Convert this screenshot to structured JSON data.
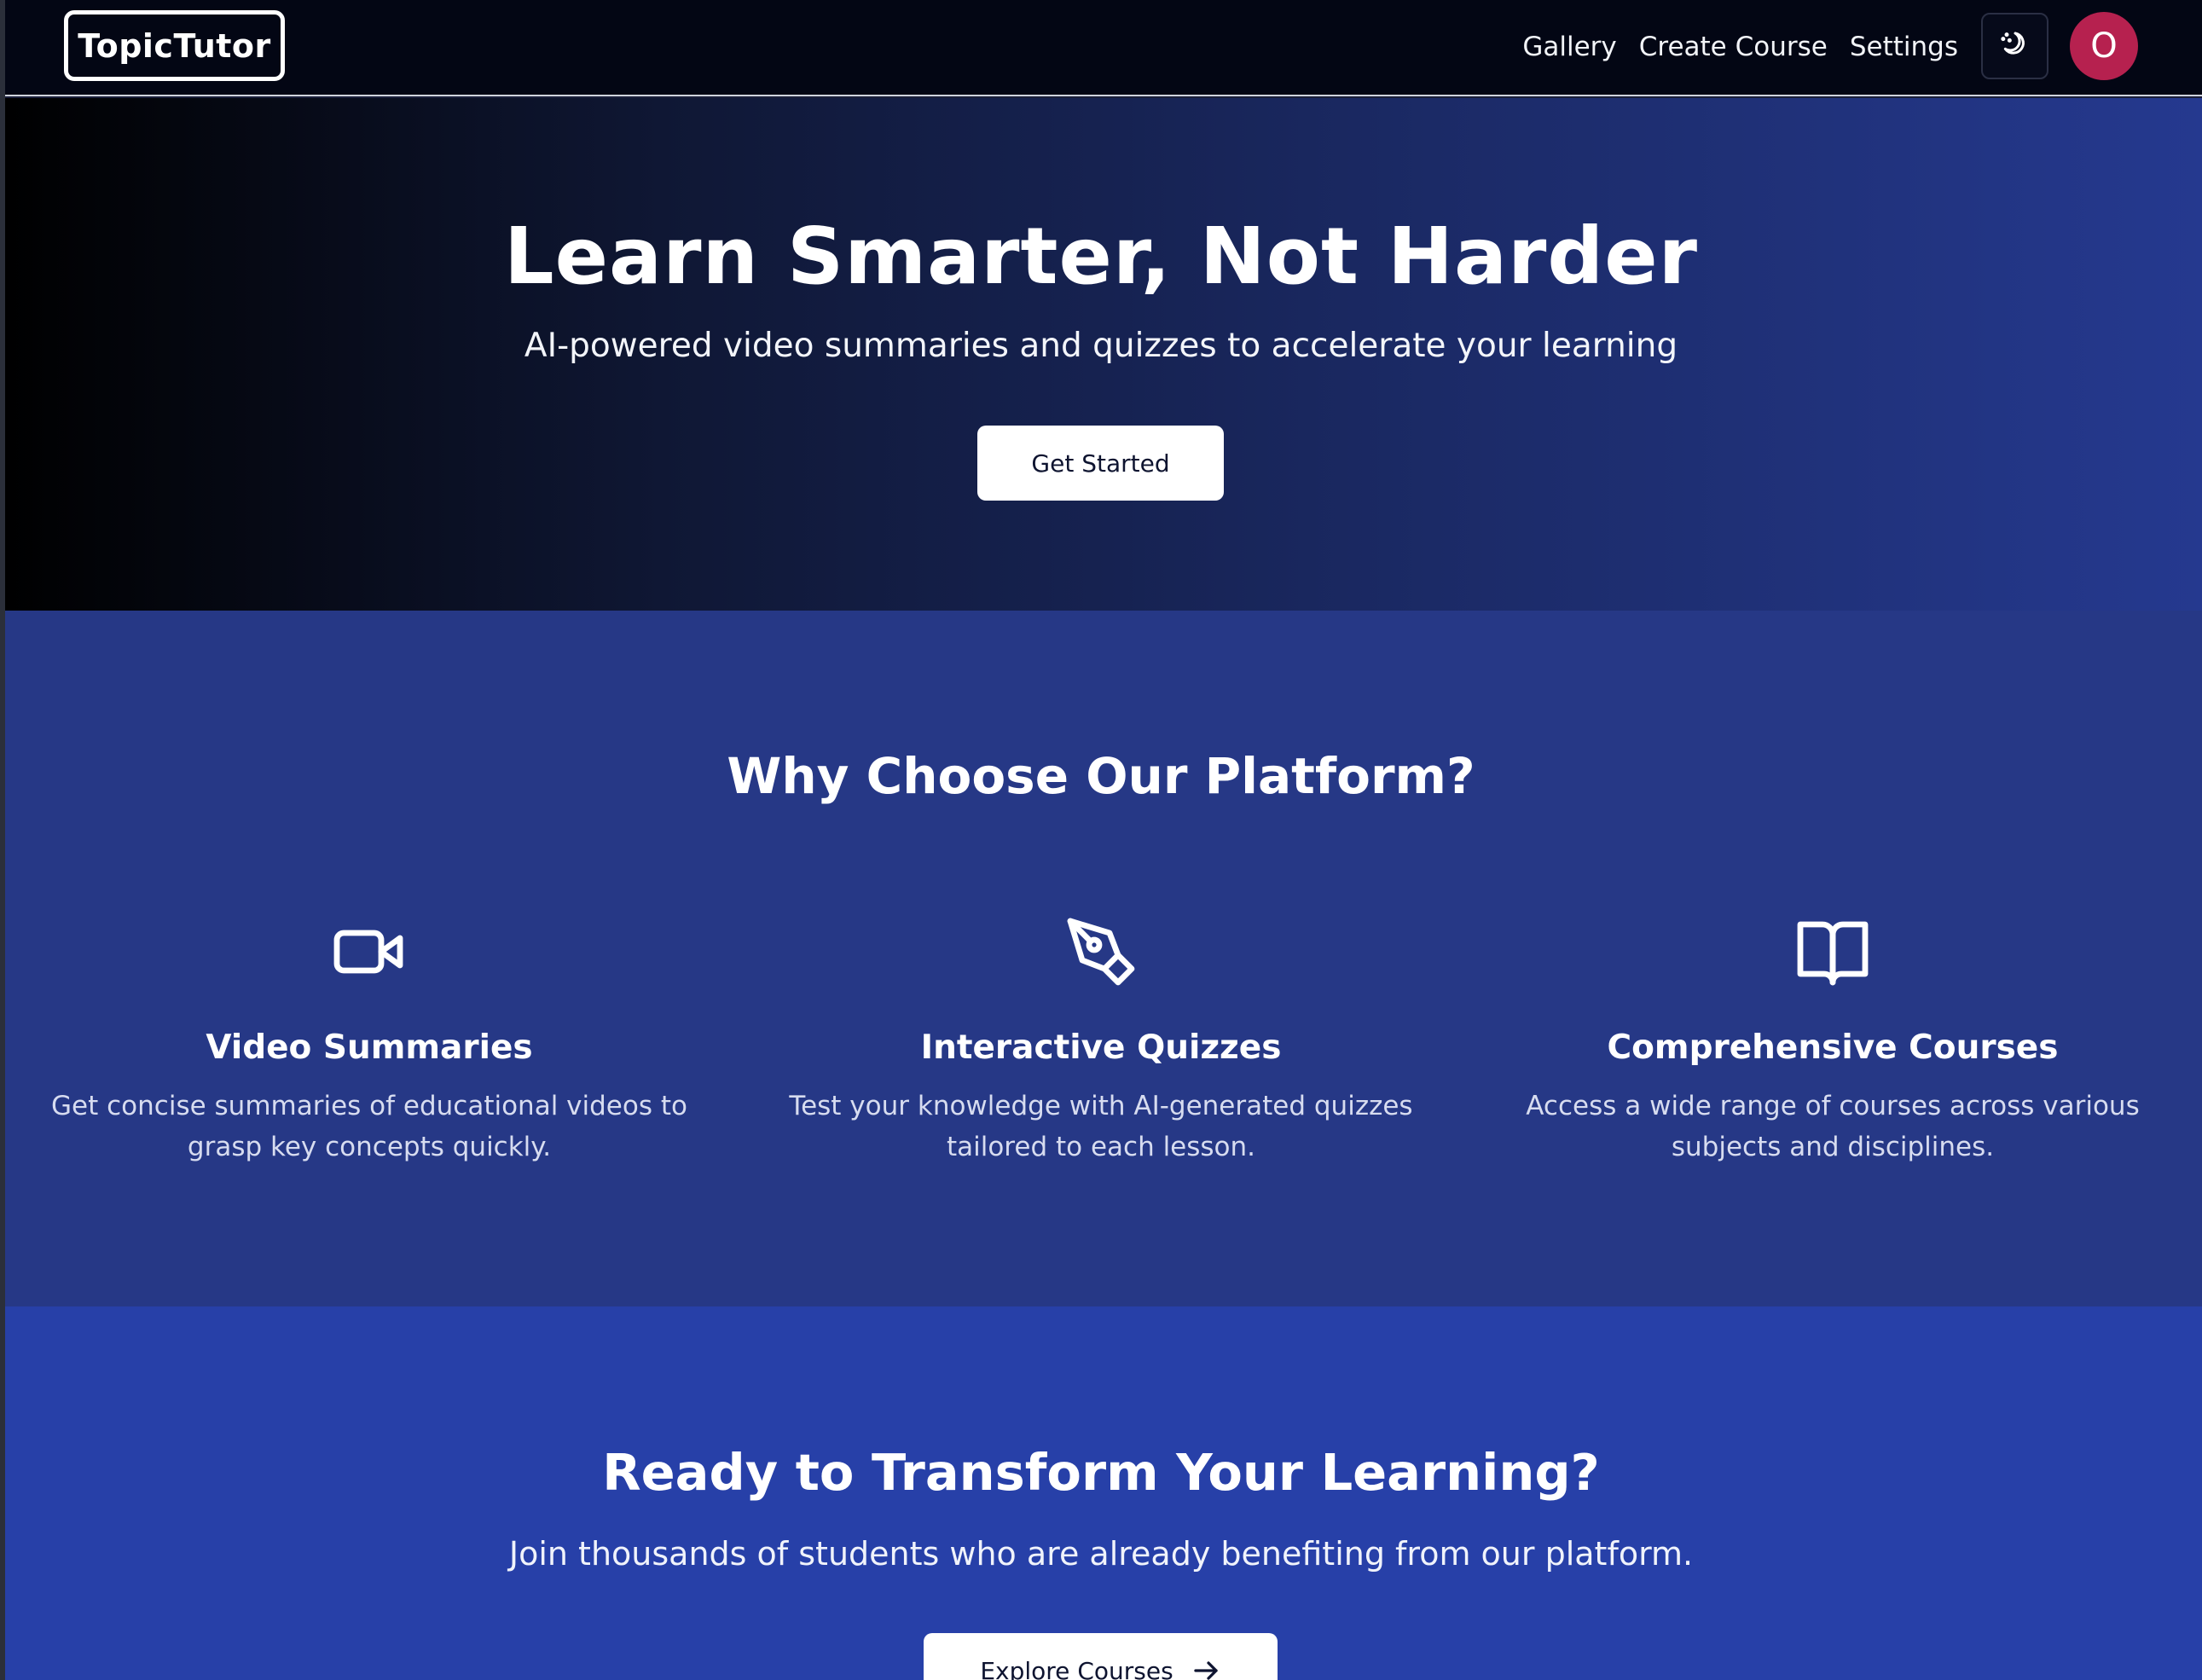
{
  "navbar": {
    "logo": "TopicTutor",
    "links": [
      "Gallery",
      "Create Course",
      "Settings"
    ],
    "theme_toggle_icon": "moon-stars-icon",
    "avatar_initial": "O",
    "avatar_color": "#b6214f"
  },
  "hero": {
    "title": "Learn Smarter, Not Harder",
    "subtitle": "AI-powered video summaries and quizzes to accelerate your learning",
    "cta_label": "Get Started"
  },
  "features": {
    "title": "Why Choose Our Platform?",
    "items": [
      {
        "icon": "video-camera-icon",
        "title": "Video Summaries",
        "description": "Get concise summaries of educational videos to grasp key concepts quickly."
      },
      {
        "icon": "pen-tool-icon",
        "title": "Interactive Quizzes",
        "description": "Test your knowledge with AI-generated quizzes tailored to each lesson."
      },
      {
        "icon": "open-book-icon",
        "title": "Comprehensive Courses",
        "description": "Access a wide range of courses across various subjects and disciplines."
      }
    ]
  },
  "cta": {
    "title": "Ready to Transform Your Learning?",
    "subtitle": "Join thousands of students who are already benefiting from our platform.",
    "button_label": "Explore Courses",
    "button_icon": "arrow-right-icon"
  },
  "colors": {
    "nav_bg": "#030614",
    "features_bg": "#263886",
    "cta_bg": "#2740a8",
    "button_bg": "#ffffff"
  }
}
